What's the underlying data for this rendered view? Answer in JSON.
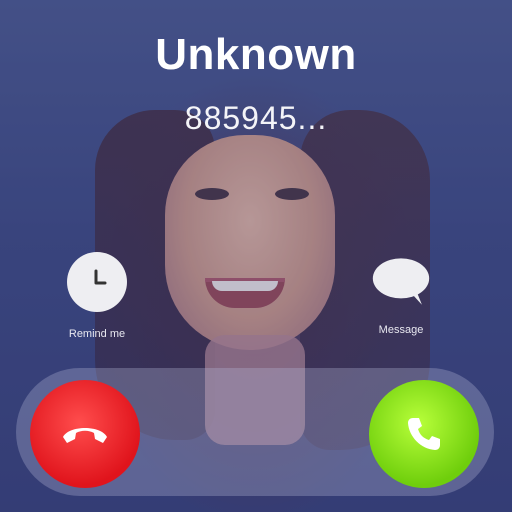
{
  "caller": {
    "name": "Unknown",
    "number": "885945..."
  },
  "actions": [
    {
      "label": "Remind me",
      "icon": "clock-icon"
    },
    {
      "label": "Message",
      "icon": "speech-bubble-icon"
    }
  ],
  "call_controls": {
    "decline": {
      "icon": "phone-hangup-icon",
      "color": "#e0141c"
    },
    "accept": {
      "icon": "phone-icon",
      "color": "#6fce0c"
    }
  }
}
